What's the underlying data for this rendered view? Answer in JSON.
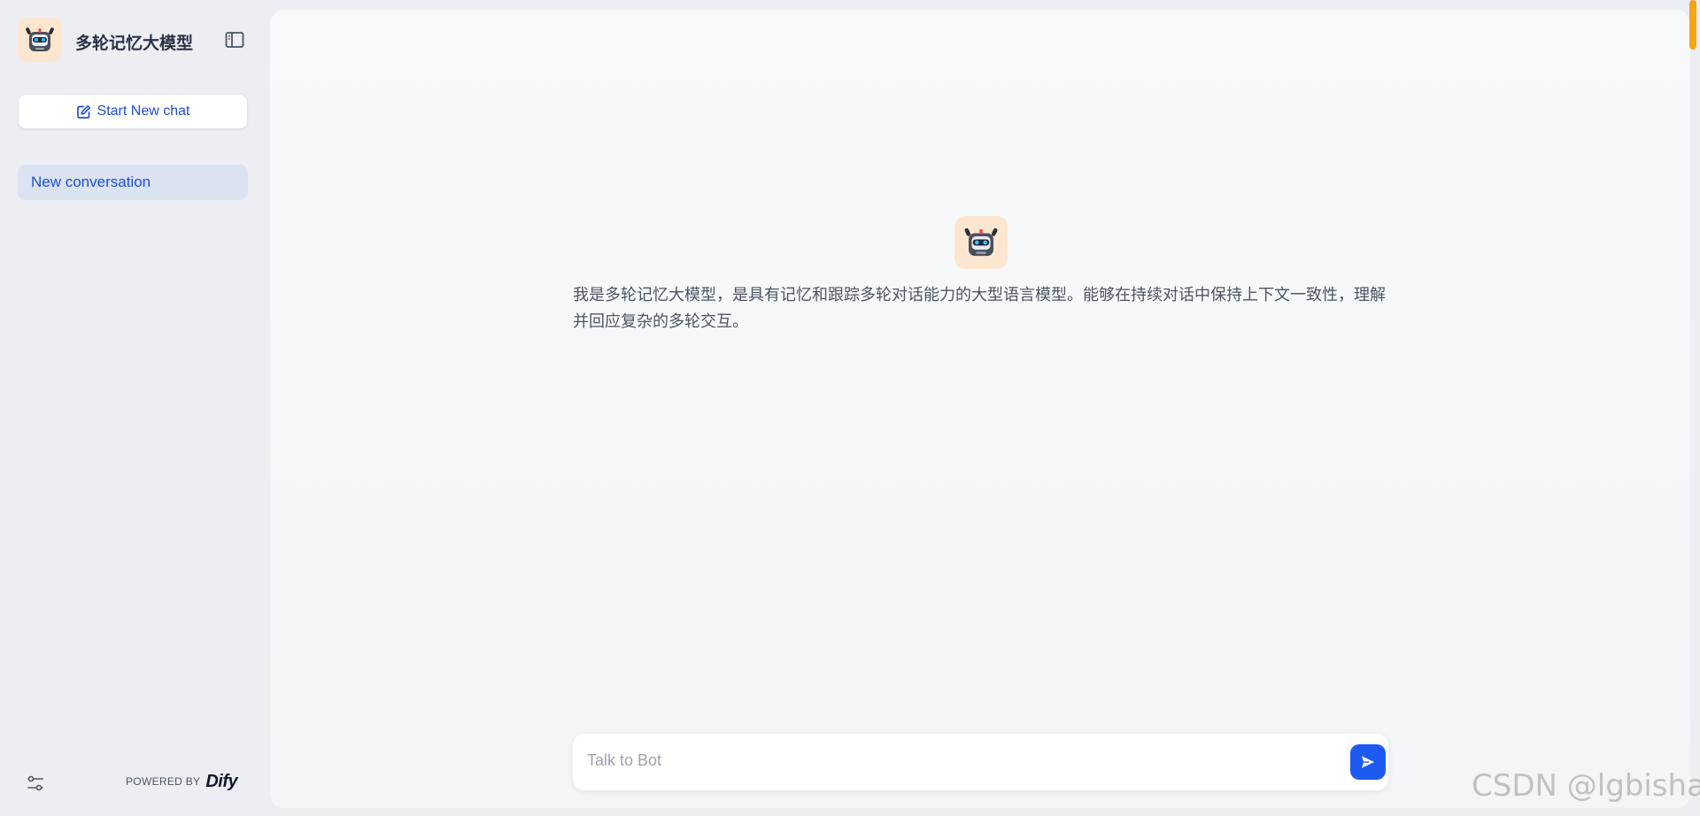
{
  "app": {
    "title": "多轮记忆大模型"
  },
  "sidebar": {
    "new_chat_label": "Start New chat",
    "conversations": [
      {
        "label": "New conversation",
        "active": true
      }
    ],
    "powered_by": "POWERED BY",
    "brand": "Dify"
  },
  "main": {
    "welcome_text": "我是多轮记忆大模型，是具有记忆和跟踪多轮对话能力的大型语言模型。能够在持续对话中保持上下文一致性，理解并回应复杂的多轮交互。",
    "input_placeholder": "Talk to Bot",
    "input_value": ""
  },
  "watermark": "CSDN @lgbisha",
  "colors": {
    "accent": "#1d4ed8",
    "send_button": "#1d5bf0",
    "avatar_bg": "#fde6cf",
    "active_item_bg": "#dbe3f1",
    "scrollbar": "#f6a316"
  },
  "icons": {
    "app_avatar": "robot-icon",
    "collapse": "sidebar-toggle-icon",
    "new_chat": "edit-icon",
    "settings": "sliders-icon",
    "send": "send-icon"
  }
}
